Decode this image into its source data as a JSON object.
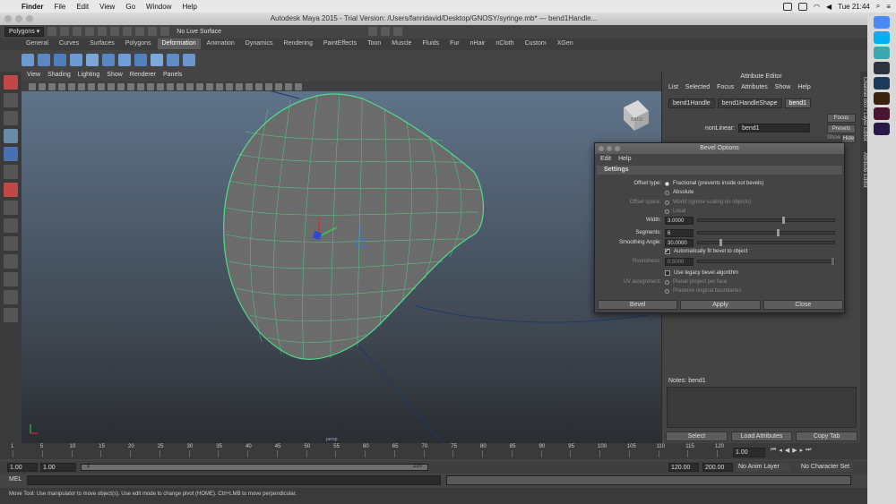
{
  "mac_menubar": {
    "items": [
      "Finder",
      "File",
      "Edit",
      "View",
      "Go",
      "Window",
      "Help"
    ],
    "clock": "Tue 21:44"
  },
  "window": {
    "title": "Autodesk Maya 2015 - Trial Version: /Users/fanridavid/Desktop/GNOSY/syringe.mb* --- bend1Handle..."
  },
  "status_line": {
    "menu_set": "Polygons",
    "live_surface": "No Live Surface"
  },
  "shelf": {
    "tabs": [
      "General",
      "Curves",
      "Surfaces",
      "Polygons",
      "Deformation",
      "Animation",
      "Dynamics",
      "Rendering",
      "PaintEffects",
      "Toon",
      "Muscle",
      "Fluids",
      "Fur",
      "nHair",
      "nCloth",
      "Custom",
      "XGen"
    ],
    "active_tab": "Deformation"
  },
  "viewport": {
    "menu": [
      "View",
      "Shading",
      "Lighting",
      "Show",
      "Renderer",
      "Panels"
    ],
    "viewcube_label": "BACK",
    "camera_label": "persp"
  },
  "attribute_editor": {
    "title": "Attribute Editor",
    "menu": [
      "List",
      "Selected",
      "Focus",
      "Attributes",
      "Show",
      "Help"
    ],
    "node_tabs": [
      "bend1Handle",
      "bend1HandleShape",
      "bend1"
    ],
    "active_tab": "bend1",
    "node_type_label": "nonLinear:",
    "node_name": "bend1",
    "focus_button": "Focus",
    "presets_button": "Presets",
    "show_label": "Show",
    "hide_button": "Hide",
    "notes_label": "Notes:",
    "notes_node": "bend1",
    "bottom_buttons": [
      "Select",
      "Load Attributes",
      "Copy Tab"
    ]
  },
  "side_strip": {
    "labels": [
      "Channel Box / Layer Editor",
      "Attribute Editor"
    ]
  },
  "bevel_dialog": {
    "title": "Bevel Options",
    "menu": [
      "Edit",
      "Help"
    ],
    "section": "Settings",
    "offset_type_label": "Offset type:",
    "offset_type_options": [
      "Fractional (prevents inside out bevels)",
      "Absolute"
    ],
    "offset_space_label": "Offset space:",
    "offset_space_options": [
      "World (ignore scaling on objects)",
      "Local"
    ],
    "width_label": "Width:",
    "width_value": "3.0000",
    "segments_label": "Segments:",
    "segments_value": "6",
    "smoothing_label": "Smoothing Angle:",
    "smoothing_value": "30.0000",
    "auto_fit_label": "Automatically fit bevel to object",
    "roundness_label": "Roundness:",
    "roundness_value": "0.5000",
    "legacy_label": "Use legacy bevel algorithm",
    "uv_label": "UV assignment:",
    "uv_options": [
      "Planar project per face",
      "Preserve original boundaries"
    ],
    "buttons": [
      "Bevel",
      "Apply",
      "Close"
    ]
  },
  "timeslider": {
    "ticks": [
      "1",
      "5",
      "10",
      "15",
      "20",
      "25",
      "30",
      "35",
      "40",
      "45",
      "50",
      "55",
      "60",
      "65",
      "70",
      "75",
      "80",
      "85",
      "90",
      "95",
      "100",
      "105",
      "110",
      "115",
      "120"
    ],
    "current_frame": "1.00"
  },
  "range_slider": {
    "start_anim": "1.00",
    "start_range": "1.00",
    "range_start_label": "1",
    "range_end_label": "120",
    "end_range": "120.00",
    "end_anim": "200.00",
    "anim_layer": "No Anim Layer",
    "character_set": "No Character Set"
  },
  "command_line": {
    "label": "MEL"
  },
  "help_line": {
    "text": "Move Tool: Use manipulator to move object(s). Use edit mode to change pivot (HOME).  Ctrl+LMB to move perpendicular."
  },
  "dock": {
    "apps": [
      "Chrome",
      "Skype",
      "Maya",
      "Lightroom",
      "Photoshop",
      "Illustrator",
      "InDesign",
      "Premiere"
    ]
  },
  "colors": {
    "wireframe": "#4fdd8c",
    "viewport_top": "#5f7389",
    "viewport_bottom": "#2a2d31",
    "ui_panel": "#444444"
  }
}
